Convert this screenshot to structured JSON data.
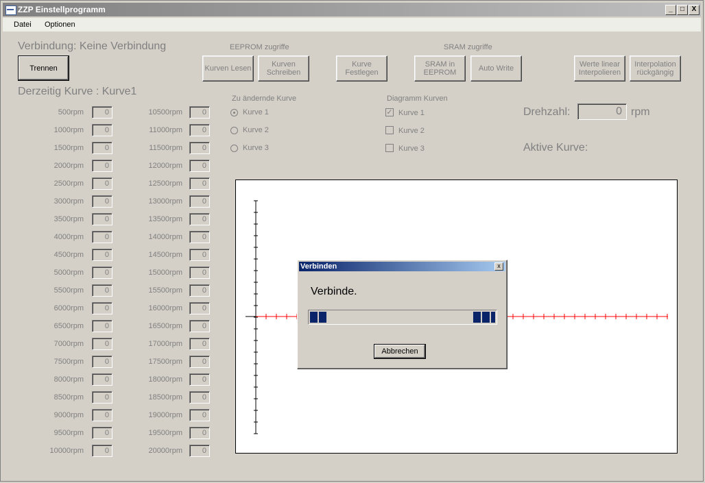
{
  "window": {
    "title": "ZZP Einstellprogramm"
  },
  "caption_buttons": [
    "_",
    "□",
    "X"
  ],
  "menu": [
    {
      "label": "Datei"
    },
    {
      "label": "Optionen"
    }
  ],
  "connection": {
    "status_text": "Verbindung: Keine Verbindung",
    "disconnect_button": "Trennen"
  },
  "current_curve": {
    "text": "Derzeitig Kurve : Kurve1"
  },
  "eeprom": {
    "title": "EEPROM zugriffe",
    "read_button": "Kurven Lesen",
    "write_button": "Kurven Schreiben"
  },
  "set_curve_button": "Kurve Festlegen",
  "sram": {
    "title": "SRAM zugriffe",
    "to_eeprom_button": "SRAM in EEPROM",
    "auto_write_button": "Auto Write"
  },
  "interp_linear_button": "Werte linear Interpolieren",
  "interp_undo_button": "Interpolation rückgängig",
  "rpm_left": [
    {
      "label": "500rpm",
      "value": "0"
    },
    {
      "label": "1000rpm",
      "value": "0"
    },
    {
      "label": "1500rpm",
      "value": "0"
    },
    {
      "label": "2000rpm",
      "value": "0"
    },
    {
      "label": "2500rpm",
      "value": "0"
    },
    {
      "label": "3000rpm",
      "value": "0"
    },
    {
      "label": "3500rpm",
      "value": "0"
    },
    {
      "label": "4000rpm",
      "value": "0"
    },
    {
      "label": "4500rpm",
      "value": "0"
    },
    {
      "label": "5000rpm",
      "value": "0"
    },
    {
      "label": "5500rpm",
      "value": "0"
    },
    {
      "label": "6000rpm",
      "value": "0"
    },
    {
      "label": "6500rpm",
      "value": "0"
    },
    {
      "label": "7000rpm",
      "value": "0"
    },
    {
      "label": "7500rpm",
      "value": "0"
    },
    {
      "label": "8000rpm",
      "value": "0"
    },
    {
      "label": "8500rpm",
      "value": "0"
    },
    {
      "label": "9000rpm",
      "value": "0"
    },
    {
      "label": "9500rpm",
      "value": "0"
    },
    {
      "label": "10000rpm",
      "value": "0"
    }
  ],
  "rpm_right": [
    {
      "label": "10500rpm",
      "value": "0"
    },
    {
      "label": "11000rpm",
      "value": "0"
    },
    {
      "label": "11500rpm",
      "value": "0"
    },
    {
      "label": "12000rpm",
      "value": "0"
    },
    {
      "label": "12500rpm",
      "value": "0"
    },
    {
      "label": "13000rpm",
      "value": "0"
    },
    {
      "label": "13500rpm",
      "value": "0"
    },
    {
      "label": "14000rpm",
      "value": "0"
    },
    {
      "label": "14500rpm",
      "value": "0"
    },
    {
      "label": "15000rpm",
      "value": "0"
    },
    {
      "label": "15500rpm",
      "value": "0"
    },
    {
      "label": "16000rpm",
      "value": "0"
    },
    {
      "label": "16500rpm",
      "value": "0"
    },
    {
      "label": "17000rpm",
      "value": "0"
    },
    {
      "label": "17500rpm",
      "value": "0"
    },
    {
      "label": "18000rpm",
      "value": "0"
    },
    {
      "label": "18500rpm",
      "value": "0"
    },
    {
      "label": "19000rpm",
      "value": "0"
    },
    {
      "label": "19500rpm",
      "value": "0"
    },
    {
      "label": "20000rpm",
      "value": "0"
    }
  ],
  "edit_curve": {
    "title": "Zu ändernde Kurve",
    "options": [
      {
        "label": "Kurve 1",
        "selected": true
      },
      {
        "label": "Kurve 2",
        "selected": false
      },
      {
        "label": "Kurve 3",
        "selected": false
      }
    ]
  },
  "diagram_curves": {
    "title": "Diagramm Kurven",
    "options": [
      {
        "label": "Kurve 1",
        "checked": true
      },
      {
        "label": "Kurve 2",
        "checked": false
      },
      {
        "label": "Kurve 3",
        "checked": false
      }
    ]
  },
  "speed": {
    "label": "Drehzahl:",
    "value": "0",
    "unit": "rpm"
  },
  "active_curve": {
    "label": "Aktive Kurve:"
  },
  "dialog": {
    "title": "Verbinden",
    "message": "Verbinde.",
    "cancel_button": "Abbrechen",
    "close": "x"
  },
  "colors": {
    "axis_red": "#ff0000",
    "progress_blue": "#0a246a",
    "face": "#d4d0c8"
  }
}
